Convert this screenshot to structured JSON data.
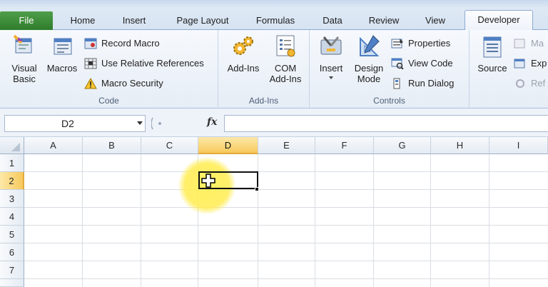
{
  "tabs": {
    "file": "File",
    "home": "Home",
    "insert": "Insert",
    "page_layout": "Page Layout",
    "formulas": "Formulas",
    "data": "Data",
    "review": "Review",
    "view": "View",
    "developer": "Developer"
  },
  "ribbon": {
    "code": {
      "label": "Code",
      "visual_basic": "Visual\nBasic",
      "macros": "Macros",
      "record_macro": "Record Macro",
      "use_relative": "Use Relative References",
      "macro_security": "Macro Security"
    },
    "addins": {
      "label": "Add-Ins",
      "add_ins": "Add-Ins",
      "com_add_ins": "COM\nAdd-Ins"
    },
    "controls": {
      "label": "Controls",
      "insert": "Insert",
      "design_mode": "Design\nMode",
      "properties": "Properties",
      "view_code": "View Code",
      "run_dialog": "Run Dialog"
    },
    "xml": {
      "source": "Source",
      "map": "Ma",
      "expansion": "Exp",
      "refresh": "Ref"
    }
  },
  "formula_bar": {
    "name_box": "D2",
    "fx": "fx",
    "formula_value": ""
  },
  "grid": {
    "columns": [
      "A",
      "B",
      "C",
      "D",
      "E",
      "F",
      "G",
      "H",
      "I"
    ],
    "rows": [
      "1",
      "2",
      "3",
      "4",
      "5",
      "6",
      "7"
    ],
    "selected_column": "D",
    "selected_row": "2"
  },
  "colors": {
    "file_tab": "#2f7d2c",
    "selected_header": "#f7c95c",
    "highlight": "#ffef5a"
  }
}
